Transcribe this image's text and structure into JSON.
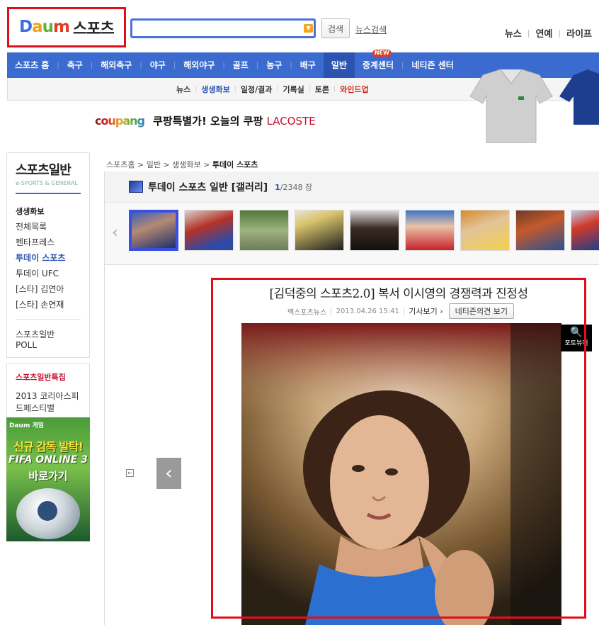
{
  "header": {
    "logo_letters": [
      "D",
      "a",
      "u",
      "m"
    ],
    "logo_sports": "스포츠",
    "search_placeholder": "",
    "search_button": "검색",
    "news_search": "뉴스검색",
    "top_links": [
      "뉴스",
      "연예",
      "라이프"
    ]
  },
  "nav": {
    "items": [
      "스포츠 홈",
      "축구",
      "해외축구",
      "야구",
      "해외야구",
      "골프",
      "농구",
      "배구",
      "일반",
      "중계센터",
      "네티즌 센터"
    ],
    "active_index": 8,
    "new_badge": "NEW"
  },
  "subnav": {
    "items": [
      "뉴스",
      "생생화보",
      "일정/결과",
      "기록실",
      "토론",
      "와인드업"
    ]
  },
  "banner": {
    "brand": "coupang",
    "text": "쿠팡특별가! 오늘의 쿠팡",
    "brand2": "LACOSTE"
  },
  "sidebar": {
    "title": "스포츠일반",
    "subtitle": "e-SPORTS & GENERAL",
    "heading": "생생화보",
    "links": [
      "전체목록",
      "펜타프레스",
      "투데이 스포츠",
      "투데이 UFC",
      "[스타] 김연아",
      "[스타] 손연재"
    ],
    "active_link": 2,
    "poll": "스포츠일반 POLL",
    "special_title": "스포츠일반특집",
    "special_link": "2013 코리아스피드페스티벌"
  },
  "game_ad": {
    "logo": "Daum 게임",
    "line1": "신규 감독 발탁!",
    "line2": "FIFA ONLINE 3",
    "line3": "바로가기"
  },
  "breadcrumb": [
    "스포츠홈",
    "일반",
    "생생화보",
    "투데이 스포츠"
  ],
  "gallery": {
    "title": "투데이 스포츠 일반 [갤러리]",
    "current": "1",
    "total": "/2348",
    "unit": "장"
  },
  "article": {
    "title": "[김덕중의 스포츠2.0] 복서 이시영의 경쟁력과 진정성",
    "source": "엑스포츠뉴스",
    "date": "2013.04.26 15:41",
    "view_article": "기사보기",
    "comment_button": "네티즌의견 보기",
    "photo_viewer": "포토뷰어"
  },
  "colors": {
    "nav_blue": "#3b6bcf",
    "highlight_red": "#e0101a"
  }
}
